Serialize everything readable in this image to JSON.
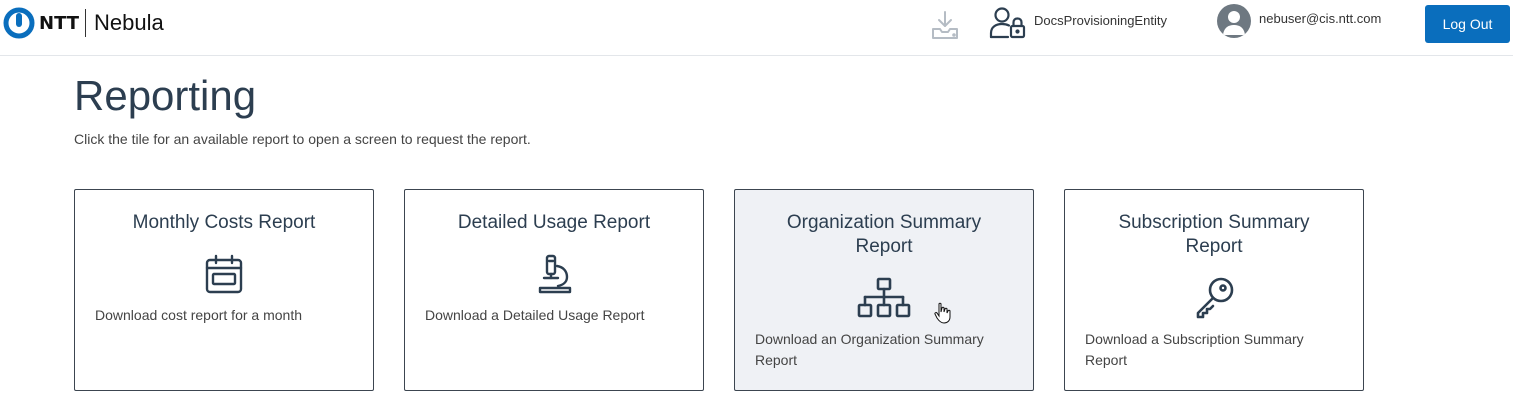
{
  "header": {
    "logo_text": "NTT",
    "app_name": "Nebula",
    "download_icon": "tray-download-icon",
    "entity_icon": "user-lock-icon",
    "entity_name": "DocsProvisioningEntity",
    "avatar_icon": "user-avatar-icon",
    "user_email": "nebuser@cis.ntt.com",
    "logout_label": "Log Out"
  },
  "page": {
    "title": "Reporting",
    "description": "Click the tile for an available report to open a screen to request the report."
  },
  "tiles": [
    {
      "title": "Monthly Costs Report",
      "description": "Download cost report for a month",
      "icon": "calendar-icon"
    },
    {
      "title": "Detailed Usage Report",
      "description": "Download a Detailed Usage Report",
      "icon": "microscope-icon"
    },
    {
      "title": "Organization Summary Report",
      "description": "Download an Organization Summary Report",
      "icon": "org-chart-icon"
    },
    {
      "title": "Subscription Summary Report",
      "description": "Download a Subscription Summary Report",
      "icon": "key-icon"
    }
  ],
  "colors": {
    "accent": "#0a6ebd",
    "text": "#2c3e50",
    "tile_hover_bg": "#eff1f5"
  }
}
